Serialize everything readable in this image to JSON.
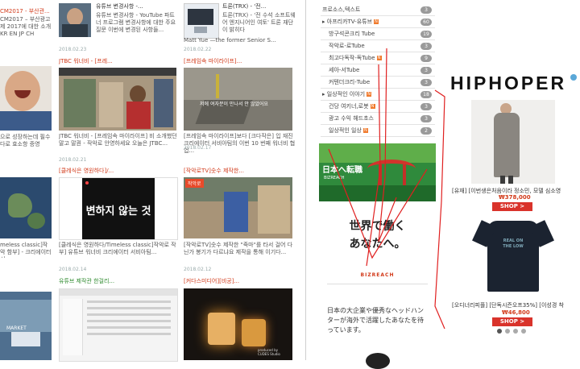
{
  "left_column": {
    "top_title": "CM2017 - 부산관...",
    "top_text": "CM2017 – 부산광고제 2017에 대한 소개 KR EN JP CH",
    "ad_mid_text": "으로 성장하는데 필수 다로 효소항 증영",
    "bottom_text": "meless classic]작악 함부] - 크리에이터 서",
    "map_label": "MARKET"
  },
  "column1": {
    "card1": {
      "title": "유튜브 변경사항 -...",
      "text": "유튜브 변경사항 - YouTube 파트너 프로그램 변경사항에 대한 주요 질문 이번에 변경된 사항들...",
      "date": "2018.02.23"
    },
    "cat1": "JTBC 워너비 - [프레...",
    "card2": {
      "text": "JTBC 워너비 - [프레임속 마이라이프] 비 소개했던 말고 말퀀 - 작악로 안영하세요 오늘은 JTBC...",
      "date": "2018.02.21"
    },
    "cat2": "[클레식은 영원하다]/...",
    "card3": {
      "video_text": "변하지 않는 것",
      "text": "[클레식은 영원하다/Timeless classic]작악로 작부] 유튜브 워너비 크리에이터 서비아팀...",
      "date": "2018.02.14"
    },
    "cat3": "유튜브 제작관 한걸리...",
    "card4": {}
  },
  "column2": {
    "card1": {
      "title": "트론(TRX) - '전...",
      "text": "트론(TRX) - '전 수석 소프트웨어 엔지니어인 여토' 트론 재단이 밝히다",
      "author": "Matt Yue —the former Senior S...",
      "date": "2018.02.22"
    },
    "cat1": "[프레임속 마이라이프]...",
    "card2": {
      "overlay": "저에 여자분이 만나서 안 않았어요",
      "text": "[프레임속 마이라이프]보다 [크다작은] 입 재진 크리에이터 서비아팀의 이번 10 번째 워너비 협업...",
      "date": "2018.02.17"
    },
    "cat2": "[작악로TV]숫수 제작한...",
    "card3": {
      "badge": "작악로",
      "text": "[작악로TV]숫수 제작한 \"죽마\"를 타서 걸어 다닌가 봉기가 다르냐요 제작을 통해 이기다...",
      "date": "2018.02.12"
    },
    "cat3": "[커다스미디어][비공]...",
    "card4": {
      "watermark": "produced by CUDES Studio"
    }
  },
  "sidebar": {
    "items": [
      {
        "label": "프로소스,텍스트",
        "count": "3",
        "arrow": false,
        "new": false
      },
      {
        "label": "아프리카TV-유튜브",
        "count": "60",
        "arrow": true,
        "new": true
      },
      {
        "label": "방구석콘크리 Tube",
        "count": "19",
        "arrow": false,
        "new": false
      },
      {
        "label": "작악로-로Tube",
        "count": "3",
        "arrow": false,
        "new": false
      },
      {
        "label": "최고다독작-독Tube",
        "count": "9",
        "arrow": false,
        "new": true
      },
      {
        "label": "세아-서Tube",
        "count": "3",
        "arrow": false,
        "new": false
      },
      {
        "label": "커텐더크리-Tube",
        "count": "3",
        "arrow": false,
        "new": false
      },
      {
        "label": "일상적인 이야기",
        "count": "18",
        "arrow": true,
        "new": true
      },
      {
        "label": "건당 여키너,로봇",
        "count": "3",
        "arrow": false,
        "new": true
      },
      {
        "label": "광고 수익 헤드초스",
        "count": "3",
        "arrow": false,
        "new": false
      },
      {
        "label": "일상적인 일상",
        "count": "2",
        "arrow": false,
        "new": true
      }
    ]
  },
  "jp_ad": {
    "banner_text": "日本へ転職",
    "brand_small": "BIZREACH",
    "headline_line1": "世界で働く",
    "headline_line2": "あなたへ。",
    "brand_large": "BIZREACH",
    "body": "日本の大企業や優秀なヘッドハンターが海外で活躍したあなたを待っています。"
  },
  "hiphoper_ad": {
    "logo": "HIPHOPER",
    "product1": {
      "name": "[유재] [이번생은처음이라 정소민, 모델 심소영",
      "price": "₩378,000",
      "button": "SHOP >"
    },
    "product2": {
      "name": "[오디너리피플] [단독시즌오프35%] [이성경 착",
      "price": "₩46,800",
      "button": "SHOP >",
      "shirt_text": "REAL ON THE LOW"
    }
  },
  "colors": {
    "accent_red": "#d9332b",
    "annotation_red": "#e02020",
    "count_badge": "#9a9a9a",
    "new_badge": "#f07a2c"
  }
}
